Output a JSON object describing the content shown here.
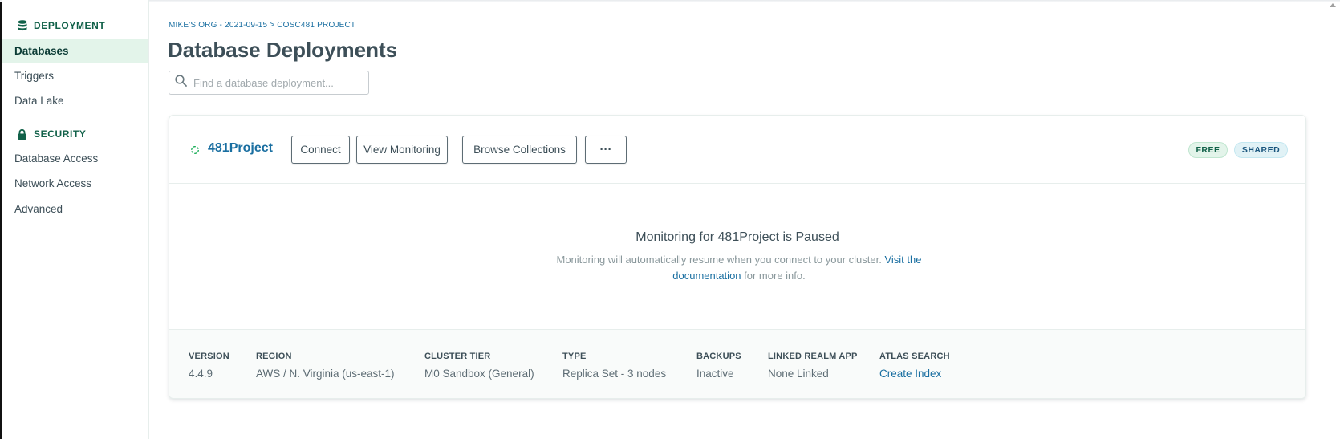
{
  "sidebar": {
    "deployment_header": "DEPLOYMENT",
    "security_header": "SECURITY",
    "items": [
      {
        "label": "Databases"
      },
      {
        "label": "Triggers"
      },
      {
        "label": "Data Lake"
      },
      {
        "label": "Database Access"
      },
      {
        "label": "Network Access"
      },
      {
        "label": "Advanced"
      }
    ]
  },
  "breadcrumb": "MIKE'S ORG - 2021-09-15 > COSC481 PROJECT",
  "page_title": "Database Deployments",
  "search": {
    "placeholder": "Find a database deployment..."
  },
  "cluster": {
    "name": "481Project",
    "buttons": {
      "connect": "Connect",
      "view_monitoring": "View Monitoring",
      "browse_collections": "Browse Collections",
      "more": "···"
    },
    "badges": {
      "free": "FREE",
      "shared": "SHARED"
    },
    "monitoring": {
      "title": "Monitoring for 481Project is Paused",
      "desc_before": "Monitoring will automatically resume when you connect to your cluster. ",
      "desc_link": "Visit the documentation",
      "desc_after": " for more info."
    },
    "details": [
      {
        "label": "VERSION",
        "value": "4.4.9"
      },
      {
        "label": "REGION",
        "value": "AWS / N. Virginia (us-east-1)"
      },
      {
        "label": "CLUSTER TIER",
        "value": "M0 Sandbox (General)"
      },
      {
        "label": "TYPE",
        "value": "Replica Set - 3 nodes"
      },
      {
        "label": "BACKUPS",
        "value": "Inactive"
      },
      {
        "label": "LINKED REALM APP",
        "value": "None Linked"
      },
      {
        "label": "ATLAS SEARCH",
        "value": "Create Index"
      }
    ]
  },
  "colors": {
    "brand_green": "#116149",
    "active_bg": "#e3f4ea",
    "link_blue": "#1a6fa1"
  }
}
